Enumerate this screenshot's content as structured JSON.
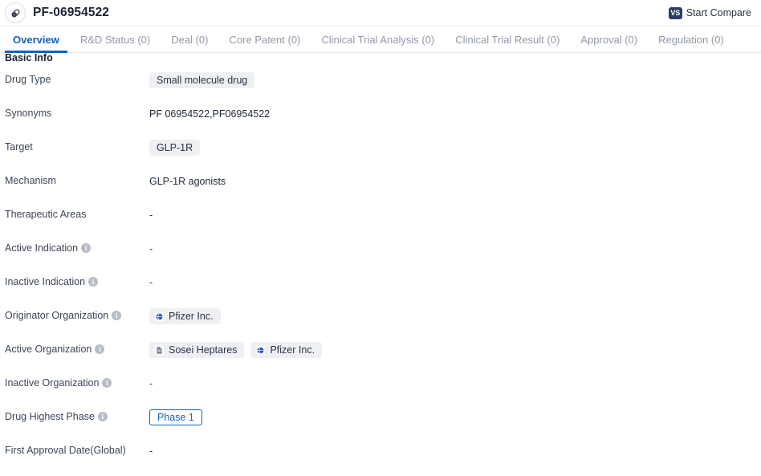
{
  "header": {
    "drug_icon": "pill-icon",
    "title": "PF-06954522",
    "compare_label": "Start Compare",
    "compare_badge": "VS",
    "accent_color": "#1063c0",
    "badge_color": "#2c3e63"
  },
  "tabs": [
    {
      "label": "Overview",
      "active": true
    },
    {
      "label": "R&D Status (0)",
      "active": false
    },
    {
      "label": "Deal (0)",
      "active": false
    },
    {
      "label": "Core Patent (0)",
      "active": false
    },
    {
      "label": "Clinical Trial Analysis (0)",
      "active": false
    },
    {
      "label": "Clinical Trial Result (0)",
      "active": false
    },
    {
      "label": "Approval (0)",
      "active": false
    },
    {
      "label": "Regulation (0)",
      "active": false
    }
  ],
  "section": {
    "title": "Basic Info"
  },
  "rows": [
    {
      "label": "Drug Type",
      "has_info": false,
      "type": "chips",
      "chips": [
        {
          "text": "Small molecule drug",
          "icon": null
        }
      ]
    },
    {
      "label": "Synonyms",
      "has_info": false,
      "type": "text",
      "text": "PF 06954522,PF06954522"
    },
    {
      "label": "Target",
      "has_info": false,
      "type": "chips",
      "chips": [
        {
          "text": "GLP-1R",
          "icon": null
        }
      ]
    },
    {
      "label": "Mechanism",
      "has_info": false,
      "type": "text",
      "text": "GLP-1R agonists"
    },
    {
      "label": "Therapeutic Areas",
      "has_info": false,
      "type": "empty",
      "text": "-"
    },
    {
      "label": "Active Indication",
      "has_info": true,
      "type": "empty",
      "text": "-"
    },
    {
      "label": "Inactive Indication",
      "has_info": true,
      "type": "empty",
      "text": "-"
    },
    {
      "label": "Originator Organization",
      "has_info": true,
      "type": "chips",
      "chips": [
        {
          "text": "Pfizer Inc.",
          "icon": "company-globe-icon"
        }
      ]
    },
    {
      "label": "Active Organization",
      "has_info": true,
      "type": "chips",
      "chips": [
        {
          "text": "Sosei Heptares",
          "icon": "company-document-icon"
        },
        {
          "text": "Pfizer Inc.",
          "icon": "company-globe-icon"
        }
      ]
    },
    {
      "label": "Inactive Organization",
      "has_info": true,
      "type": "empty",
      "text": "-"
    },
    {
      "label": "Drug Highest Phase",
      "has_info": true,
      "type": "badge",
      "badge": "Phase 1"
    },
    {
      "label": "First Approval Date(Global)",
      "has_info": false,
      "type": "empty",
      "text": "-"
    }
  ]
}
